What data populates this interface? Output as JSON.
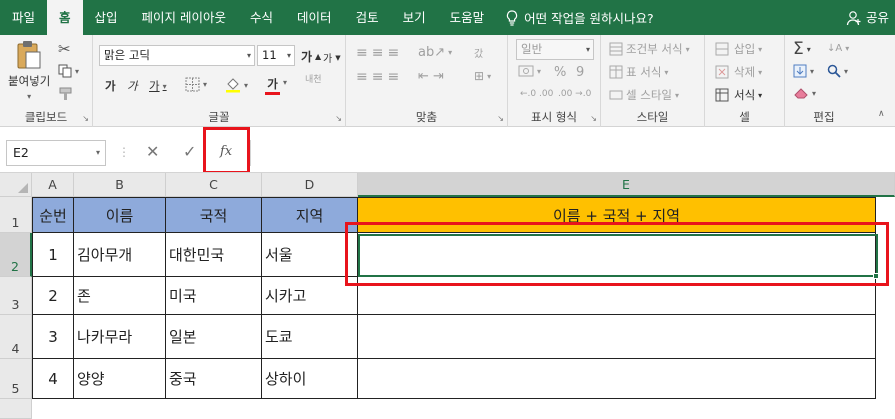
{
  "tabs": [
    "파일",
    "홈",
    "삽입",
    "페이지 레이아웃",
    "수식",
    "데이터",
    "검토",
    "보기",
    "도움말"
  ],
  "active_tab": "홈",
  "tell_me": "어떤 작업을 원하시나요?",
  "share_label": "공유",
  "ribbon": {
    "clipboard": {
      "paste": "붙여넣기",
      "label": "클립보드"
    },
    "font": {
      "name": "맑은 고딕",
      "size": "11",
      "grow": "가",
      "shrink": "가",
      "bold": "가",
      "italic": "가",
      "underline": "가",
      "font_color_glyph": "가",
      "phonetic": "내천",
      "label": "글꼴"
    },
    "alignment": {
      "wrap": "갔",
      "label": "맞춤"
    },
    "number": {
      "format": "일반",
      "percent": "%",
      "comma": "9",
      "label": "표시 형식"
    },
    "styles": {
      "conditional": "조건부 서식",
      "table": "표 서식",
      "cell_style": "셀 스타일",
      "label": "스타일"
    },
    "cells": {
      "insert": "삽입",
      "delete": "삭제",
      "format": "서식",
      "label": "셀"
    },
    "editing": {
      "label": "편집"
    }
  },
  "formula_bar": {
    "name_box": "E2",
    "fx": "fx",
    "formula": ""
  },
  "grid": {
    "columns": [
      "A",
      "B",
      "C",
      "D",
      "E"
    ],
    "rows": [
      "1",
      "2",
      "3",
      "4",
      "5"
    ],
    "header": [
      "순번",
      "이름",
      "국적",
      "지역",
      "이름 + 국적 + 지역"
    ],
    "data": [
      [
        "1",
        "김아무개",
        "대한민국",
        "서울",
        ""
      ],
      [
        "2",
        "존",
        "미국",
        "시카고",
        ""
      ],
      [
        "3",
        "나카무라",
        "일본",
        "도쿄",
        ""
      ],
      [
        "4",
        "양양",
        "중국",
        "상하이",
        ""
      ]
    ],
    "selected_cell": "E2"
  },
  "colors": {
    "excel_green": "#217346",
    "header_blue": "#8eaadb",
    "header_gold": "#ffc000",
    "highlight_red": "#e8141c"
  }
}
